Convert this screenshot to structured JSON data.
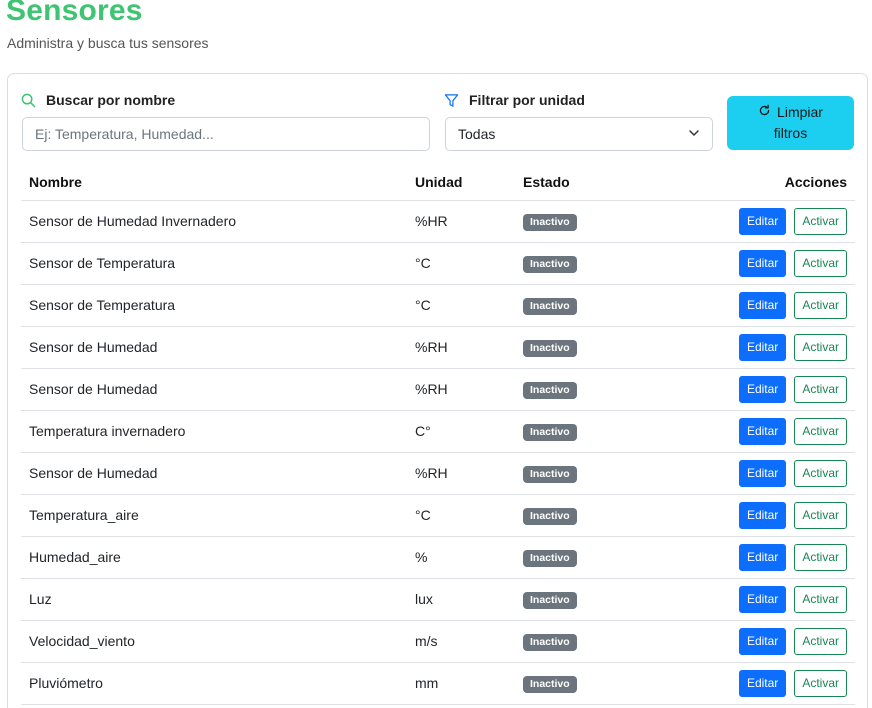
{
  "header": {
    "title": "Sensores",
    "subtitle": "Administra y busca tus sensores"
  },
  "filters": {
    "search_label": "Buscar por nombre",
    "search_placeholder": "Ej: Temperatura, Humedad...",
    "search_value": "",
    "unit_label": "Filtrar por unidad",
    "unit_selected": "Todas",
    "clear_label_line1": "Limpiar",
    "clear_label_line2": "filtros",
    "icons": {
      "search": "search-icon",
      "filter": "filter-icon",
      "reset": "refresh-icon",
      "dropdown": "chevron-down-icon"
    },
    "accent_color": "#3ec472",
    "clear_button_color": "#1ccff0"
  },
  "table": {
    "columns": [
      "Nombre",
      "Unidad",
      "Estado",
      "Acciones"
    ],
    "edit_label": "Editar",
    "activate_label": "Activar",
    "rows": [
      {
        "name": "Sensor de Humedad Invernadero",
        "unit": "%HR",
        "status": "Inactivo"
      },
      {
        "name": "Sensor de Temperatura",
        "unit": "°C",
        "status": "Inactivo"
      },
      {
        "name": "Sensor de Temperatura",
        "unit": "°C",
        "status": "Inactivo"
      },
      {
        "name": "Sensor de Humedad",
        "unit": "%RH",
        "status": "Inactivo"
      },
      {
        "name": "Sensor de Humedad",
        "unit": "%RH",
        "status": "Inactivo"
      },
      {
        "name": "Temperatura invernadero",
        "unit": "C°",
        "status": "Inactivo"
      },
      {
        "name": "Sensor de Humedad",
        "unit": "%RH",
        "status": "Inactivo"
      },
      {
        "name": "Temperatura_aire",
        "unit": "°C",
        "status": "Inactivo"
      },
      {
        "name": "Humedad_aire",
        "unit": "%",
        "status": "Inactivo"
      },
      {
        "name": "Luz",
        "unit": "lux",
        "status": "Inactivo"
      },
      {
        "name": "Velocidad_viento",
        "unit": "m/s",
        "status": "Inactivo"
      },
      {
        "name": "Pluviómetro",
        "unit": "mm",
        "status": "Inactivo"
      }
    ]
  }
}
